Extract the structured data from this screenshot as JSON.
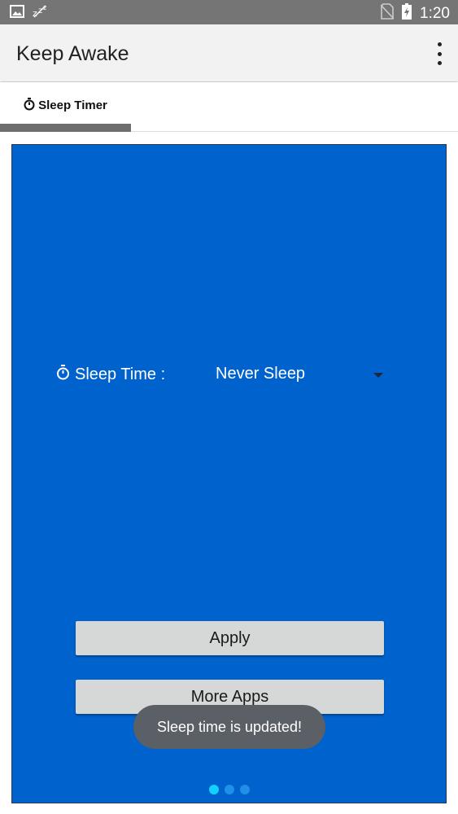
{
  "status_bar": {
    "time": "1:20",
    "icons": [
      "image-icon",
      "sleep-zzz-icon",
      "no-sim-icon",
      "battery-charging-icon"
    ]
  },
  "app_bar": {
    "title": "Keep Awake",
    "menu_icon": "overflow-menu-icon"
  },
  "tabs": [
    {
      "label": "Sleep Timer",
      "icon": "stopwatch-icon",
      "selected": true
    }
  ],
  "main": {
    "sleep_time_label": "Sleep Time :",
    "sleep_time_value": "Never Sleep",
    "apply_label": "Apply",
    "more_apps_label": "More Apps",
    "page_indicator": {
      "count": 3,
      "active_index": 0
    }
  },
  "toast": {
    "message": "Sleep time is updated!"
  },
  "colors": {
    "panel_background": "#0062cc",
    "status_bar": "#757575",
    "app_bar": "#f2f2f2",
    "button": "#d6d7d7",
    "toast": "#5b5f66",
    "active_dot": "#12d0ff"
  }
}
